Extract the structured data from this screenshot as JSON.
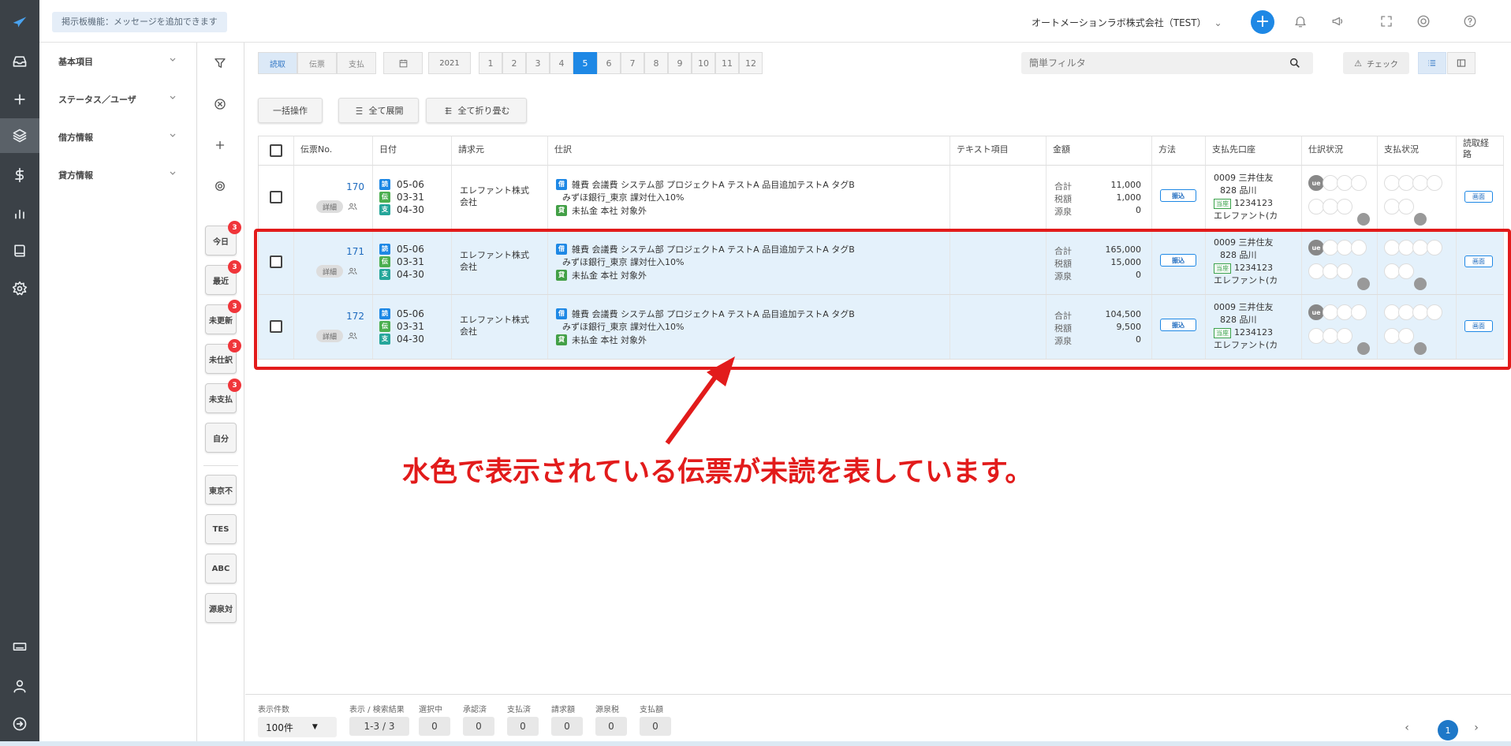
{
  "topbar": {
    "board_message": "掲示板機能：メッセージを追加できます",
    "company": "オートメーションラボ株式会社（TEST）"
  },
  "filters": [
    {
      "label": "基本項目"
    },
    {
      "label": "ステータス／ユーザ"
    },
    {
      "label": "借方情報"
    },
    {
      "label": "貸方情報"
    }
  ],
  "quick_buttons": [
    {
      "label": "今日",
      "badge": "3"
    },
    {
      "label": "最近",
      "badge": "3"
    },
    {
      "label": "未更新",
      "badge": "3"
    },
    {
      "label": "未仕訳",
      "badge": "3"
    },
    {
      "label": "未支払",
      "badge": "3"
    },
    {
      "label": "自分",
      "badge": ""
    }
  ],
  "tag_buttons": [
    {
      "label": "東京不"
    },
    {
      "label": "TES"
    },
    {
      "label": "ABC"
    },
    {
      "label": "源泉対"
    }
  ],
  "toolbar": {
    "tabs": [
      {
        "label": "読取",
        "active": true
      },
      {
        "label": "伝票",
        "active": false
      },
      {
        "label": "支払",
        "active": false
      }
    ],
    "year": "2021",
    "months": [
      "1",
      "2",
      "3",
      "4",
      "5",
      "6",
      "7",
      "8",
      "9",
      "10",
      "11",
      "12"
    ],
    "active_month": "5",
    "filter_placeholder": "簡単フィルタ",
    "check_label": "チェック"
  },
  "actions": {
    "bulk": "一括操作",
    "expand_all": "全て展開",
    "collapse_all": "全て折り畳む"
  },
  "columns": [
    "伝票No.",
    "日付",
    "請求元",
    "仕訳",
    "テキスト項目",
    "金額",
    "方法",
    "支払先口座",
    "仕訳状況",
    "支払状況",
    "読取経路"
  ],
  "rows": [
    {
      "no": "170",
      "unread": false,
      "detail": "詳細",
      "dates": [
        {
          "tag": "読",
          "color": "#1e88e5",
          "value": "05-06"
        },
        {
          "tag": "伝",
          "color": "#4caf50",
          "value": "03-31"
        },
        {
          "tag": "支",
          "color": "#26a69a",
          "value": "04-30"
        }
      ],
      "vendor": "エレファント株式会社",
      "journal_debit": "雑費  会議費  システム部  プロジェクトA  テストA  品目追加テストA  タグB",
      "journal_bank": "みずほ銀行_東京  課対仕入10%",
      "journal_credit": "未払金  本社  対象外",
      "amounts": {
        "total_label": "合計",
        "total": "11,000",
        "tax_label": "税額",
        "tax": "1,000",
        "withholding_label": "源泉",
        "withholding": "0"
      },
      "method": "振込",
      "account_line1": "0009 三井住友",
      "account_line2": "828 品川",
      "account_type": "当座",
      "account_number": "1234123",
      "account_holder": "エレファント(カ",
      "route": "画面"
    },
    {
      "no": "171",
      "unread": true,
      "detail": "詳細",
      "dates": [
        {
          "tag": "読",
          "color": "#1e88e5",
          "value": "05-06"
        },
        {
          "tag": "伝",
          "color": "#4caf50",
          "value": "03-31"
        },
        {
          "tag": "支",
          "color": "#26a69a",
          "value": "04-30"
        }
      ],
      "vendor": "エレファント株式会社",
      "journal_debit": "雑費  会議費  システム部  プロジェクトA  テストA  品目追加テストA  タグB",
      "journal_bank": "みずほ銀行_東京  課対仕入10%",
      "journal_credit": "未払金  本社  対象外",
      "amounts": {
        "total_label": "合計",
        "total": "165,000",
        "tax_label": "税額",
        "tax": "15,000",
        "withholding_label": "源泉",
        "withholding": "0"
      },
      "method": "振込",
      "account_line1": "0009 三井住友",
      "account_line2": "828 品川",
      "account_type": "当座",
      "account_number": "1234123",
      "account_holder": "エレファント(カ",
      "route": "画面"
    },
    {
      "no": "172",
      "unread": true,
      "detail": "詳細",
      "dates": [
        {
          "tag": "読",
          "color": "#1e88e5",
          "value": "05-06"
        },
        {
          "tag": "伝",
          "color": "#4caf50",
          "value": "03-31"
        },
        {
          "tag": "支",
          "color": "#26a69a",
          "value": "04-30"
        }
      ],
      "vendor": "エレファント株式会社",
      "journal_debit": "雑費  会議費  システム部  プロジェクトA  テストA  品目追加テストA  タグB",
      "journal_bank": "みずほ銀行_東京  課対仕入10%",
      "journal_credit": "未払金  本社  対象外",
      "amounts": {
        "total_label": "合計",
        "total": "104,500",
        "tax_label": "税額",
        "tax": "9,500",
        "withholding_label": "源泉",
        "withholding": "0"
      },
      "method": "振込",
      "account_line1": "0009 三井住友",
      "account_line2": "828 品川",
      "account_type": "当座",
      "account_number": "1234123",
      "account_holder": "エレファント(カ",
      "route": "画面"
    }
  ],
  "journal_tags": {
    "debit": "借",
    "credit": "貸"
  },
  "status_circle_label": "ue",
  "annotation": "水色で表示されている伝票が未読を表しています。",
  "footer": {
    "per_page_label": "表示件数",
    "per_page_value": "100件",
    "stats": [
      {
        "label": "表示 / 検索結果",
        "value": "1-3 / 3"
      },
      {
        "label": "選択中",
        "value": "0"
      },
      {
        "label": "承認済",
        "value": "0"
      },
      {
        "label": "支払済",
        "value": "0"
      },
      {
        "label": "請求額",
        "value": "0"
      },
      {
        "label": "源泉税",
        "value": "0"
      },
      {
        "label": "支払額",
        "value": "0"
      }
    ],
    "current_page": "1"
  },
  "colors": {
    "accent": "#1e88e5",
    "unread_row": "#e4f1fb",
    "annotation": "#e21b1b",
    "rail": "#3b4147"
  }
}
